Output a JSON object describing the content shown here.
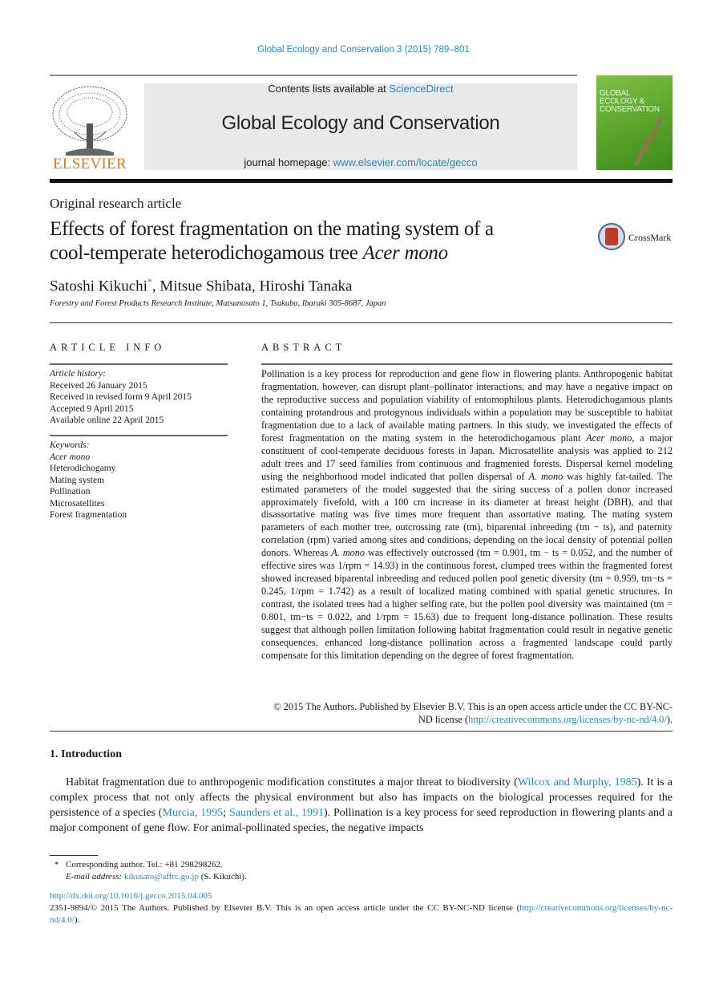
{
  "header": {
    "citation": "Global Ecology and Conservation 3 (2015) 789–801",
    "contents_prefix": "Contents lists available at ",
    "contents_link": "ScienceDirect",
    "journal_title": "Global Ecology and Conservation",
    "homepage_prefix": "journal homepage: ",
    "homepage_link": "www.elsevier.com/locate/gecco",
    "publisher_logo_text": "ELSEVIER",
    "cover_text": [
      "GLOBAL",
      "ECOLOGY &",
      "CONSERVATION"
    ]
  },
  "article": {
    "type": "Original research article",
    "title_line1": "Effects of forest fragmentation on the mating system of a",
    "title_line2_prefix": "cool-temperate heterodichogamous tree ",
    "title_line2_italic": "Acer mono",
    "crossmark_label": "CrossMark",
    "authors": [
      {
        "name": "Satoshi Kikuchi",
        "mark": "*"
      },
      {
        "name": "Mitsue Shibata"
      },
      {
        "name": "Hiroshi Tanaka"
      }
    ],
    "affiliation": "Forestry and Forest Products Research Institute, Matsunosato 1, Tsukuba, Ibaraki 305-8687, Japan"
  },
  "article_info": {
    "heading": "ARTICLE INFO",
    "history_label": "Article history:",
    "history": [
      "Received 26 January 2015",
      "Received in revised form 9 April 2015",
      "Accepted 9 April 2015",
      "Available online 22 April 2015"
    ],
    "keywords_label": "Keywords:",
    "keywords": [
      "Acer mono",
      "Heterodichogamy",
      "Mating system",
      "Pollination",
      "Microsatellites",
      "Forest fragmentation"
    ]
  },
  "abstract": {
    "heading": "ABSTRACT",
    "p1": "Pollination is a key process for reproduction and gene flow in flowering plants. Anthropogenic habitat fragmentation, however, can disrupt plant–pollinator interactions, and may have a negative impact on the reproductive success and population viability of entomophilous plants. Heterodichogamous plants containing protandrous and protogynous individuals within a population may be susceptible to habitat fragmentation due to a lack of available mating partners. In this study, we investigated the effects of forest fragmentation on the mating system in the heterodichogamous plant ",
    "i1": "Acer mono",
    "p2": ", a major constituent of cool-temperate deciduous forests in Japan. Microsatellite analysis was applied to 212 adult trees and 17 seed families from continuous and fragmented forests. Dispersal kernel modeling using the neighborhood model indicated that pollen dispersal of ",
    "i2": "A. mono",
    "p3": " was highly fat-tailed. The estimated parameters of the model suggested that the siring success of a pollen donor increased approximately fivefold, with a 100 cm increase in its diameter at breast height (DBH), and that disassortative mating was five times more frequent than assortative mating. The mating system parameters of each mother tree, outcrossing rate (tm), biparental inbreeding (tm − ts), and paternity correlation (rpm) varied among sites and conditions, depending on the local density of potential pollen donors. Whereas ",
    "i3": "A. mono",
    "p4": " was effectively outcrossed (tm = 0.901, tm − ts = 0.052, and the number of effective sires was 1/rpm = 14.93) in the continuous forest, clumped trees within the fragmented forest showed increased biparental inbreeding and reduced pollen pool genetic diversity (tm = 0.959, tm−ts = 0.245, 1/rpm = 1.742) as a result of localized mating combined with spatial genetic structures. In contrast, the isolated trees had a higher selfing rate, but the pollen pool diversity was maintained (tm = 0.801, tm−ts = 0.022, and 1/rpm = 15.63) due to frequent long-distance pollination. These results suggest that although pollen limitation following habitat fragmentation could result in negative genetic consequences, enhanced long-distance pollination across a fragmented landscape could partly compensate for this limitation depending on the degree of forest fragmentation.",
    "license_prefix": "© 2015 The Authors. Published by Elsevier B.V. This is an open access article under the CC BY-NC-ND license (",
    "license_link": "http://creativecommons.org/licenses/by-nc-nd/4.0/",
    "license_suffix": ")."
  },
  "introduction": {
    "heading": "1. Introduction",
    "t1": "Habitat fragmentation due to anthropogenic modification constitutes a major threat to biodiversity (",
    "ref1": "Wilcox and Murphy, 1985",
    "t2": "). It is a complex process that not only affects the physical environment but also has impacts on the biological processes required for the persistence of a species (",
    "ref2": "Murcia, 1995",
    "t3": "; ",
    "ref3": "Saunders et al., 1991",
    "t4": "). Pollination is a key process for seed reproduction in flowering plants and a major component of gene flow. For animal-pollinated species, the negative impacts"
  },
  "footnotes": {
    "mark": "*",
    "corresponding": "Corresponding author. Tel.: +81 298298262.",
    "email_label": "E-mail address: ",
    "email": "kikusato@affrc.go.jp",
    "email_suffix": " (S. Kikuchi).",
    "doi": "http://dx.doi.org/10.1016/j.gecco.2015.04.005",
    "issn_prefix": "2351-9894/© 2015 The Authors. Published by Elsevier B.V. This is an open access article under the CC BY-NC-ND license (",
    "issn_link": "http://creativecommons.org/licenses/by-nc-nd/4.0/",
    "issn_suffix": ")."
  }
}
